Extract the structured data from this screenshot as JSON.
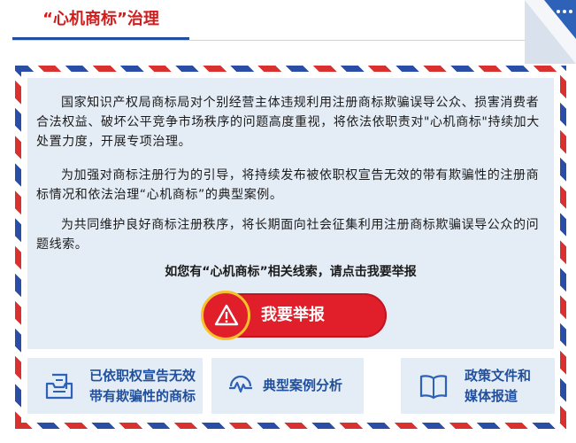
{
  "header": {
    "title": "“心机商标”治理"
  },
  "notice": {
    "paragraphs": [
      "国家知识产权局商标局对个别经营主体违规利用注册商标欺骗误导公众、损害消费者合法权益、破坏公平竞争市场秩序的问题高度重视，将依法依职责对\"心机商标\"持续加大处置力度，开展专项治理。",
      "为加强对商标注册行为的引导，将持续发布被依职权宣告无效的带有欺骗性的注册商标情况和依法治理“心机商标”的典型案例。",
      "为共同维护良好商标注册秩序，将长期面向社会征集利用注册商标欺骗误导公众的问题线索。"
    ],
    "cta": "如您有“心机商标”相关线索，请点击我要举报",
    "report_button": "我要举报"
  },
  "cards": [
    {
      "line1": "已依职权宣告无效",
      "line2": "带有欺骗性的商标",
      "icon": "document-tray-icon"
    },
    {
      "line1": "典型案例分析",
      "icon": "heartbeat-wave-icon"
    },
    {
      "line1": "政策文件和",
      "line2": "媒体报道",
      "icon": "open-book-icon"
    }
  ],
  "colors": {
    "title_red": "#d41c1c",
    "accent_blue": "#1f4f9e",
    "button_red": "#e01f2b",
    "panel_bg": "#e4edf6"
  }
}
